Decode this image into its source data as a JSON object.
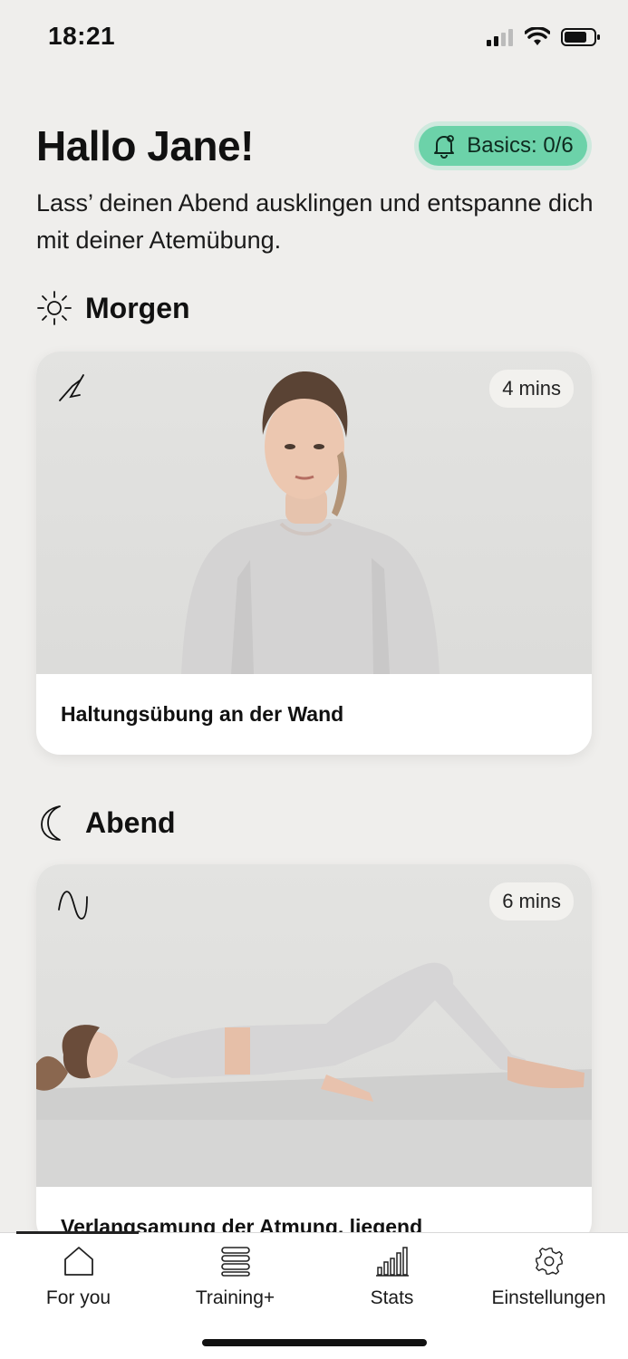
{
  "status_bar": {
    "time": "18:21"
  },
  "header": {
    "greeting": "Hallo Jane!",
    "badge_label": "Basics: 0/6",
    "subtitle": "Lass’ deinen Abend ausklingen und entspanne dich mit deiner Atemübung."
  },
  "sections": [
    {
      "title": "Morgen",
      "icon": "sun-icon",
      "card": {
        "title": "Haltungsübung an der Wand",
        "duration": "4 mins",
        "type_icon": "posture-icon"
      }
    },
    {
      "title": "Abend",
      "icon": "moon-icon",
      "card": {
        "title": "Verlangsamung der Atmung, liegend",
        "duration": "6 mins",
        "type_icon": "wave-icon"
      }
    }
  ],
  "tab_bar": {
    "tabs": [
      {
        "label": "For you",
        "icon": "home-icon",
        "active": true
      },
      {
        "label": "Training+",
        "icon": "stack-icon",
        "active": false
      },
      {
        "label": "Stats",
        "icon": "bar-chart-icon",
        "active": false
      },
      {
        "label": "Einstellungen",
        "icon": "gear-icon",
        "active": false
      }
    ]
  },
  "colors": {
    "background": "#efeeec",
    "badge_green": "#6cd2a9"
  }
}
